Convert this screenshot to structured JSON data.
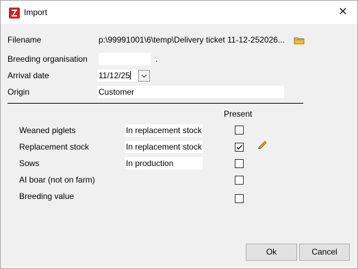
{
  "window": {
    "title": "Import",
    "close_glyph": "✕"
  },
  "form": {
    "filename": {
      "label": "Filename",
      "value": "p:\\99991001\\6\\temp\\Delivery ticket 11-12-252026..."
    },
    "breeding_organisation": {
      "label": "Breeding organisation",
      "value": "",
      "suffix": "."
    },
    "arrival_date": {
      "label": "Arrival date",
      "value": "11/12/25"
    },
    "origin": {
      "label": "Origin",
      "value": "Customer"
    }
  },
  "table": {
    "present_header": "Present",
    "rows": [
      {
        "label": "Weaned piglets",
        "status": "In replacement stock",
        "checked": false
      },
      {
        "label": "Replacement stock",
        "status": "In replacement stock",
        "checked": true
      },
      {
        "label": "Sows",
        "status": "In production",
        "checked": false
      },
      {
        "label": "AI boar (not on farm)",
        "status": "",
        "checked": false
      },
      {
        "label": "Breeding value",
        "status": "",
        "checked": false
      }
    ]
  },
  "buttons": {
    "ok": "Ok",
    "cancel": "Cancel"
  },
  "icons": {
    "app": "app-logo-icon",
    "folder": "folder-icon",
    "dropdown": "chevron-down-icon",
    "edit": "pencil-icon"
  },
  "colors": {
    "app_icon": "#d32020",
    "folder": "#e8c14a",
    "pencil": "#e0a020"
  }
}
